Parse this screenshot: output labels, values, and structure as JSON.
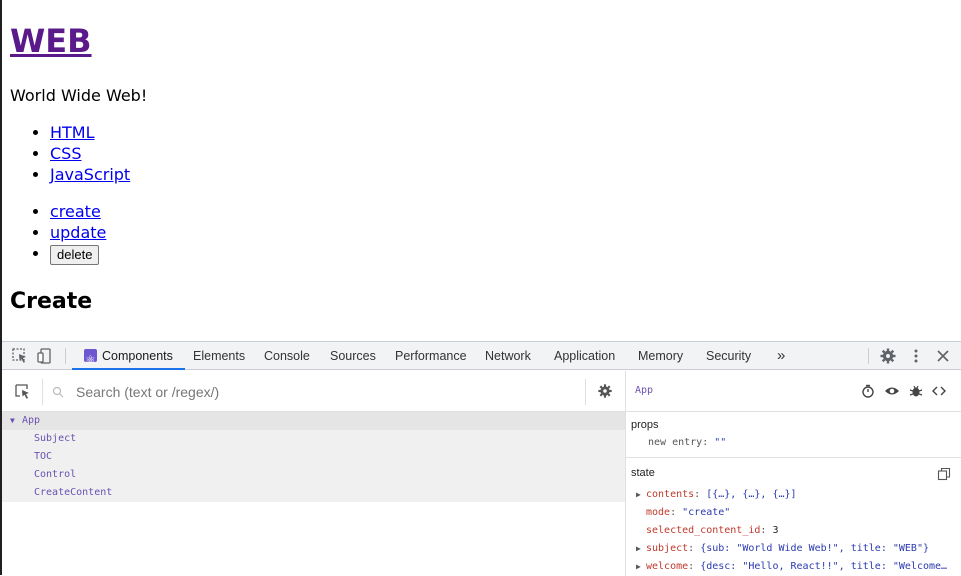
{
  "page": {
    "title": "WEB",
    "description": "World Wide Web!",
    "toc": [
      "HTML",
      "CSS",
      "JavaScript"
    ],
    "controls": {
      "create": "create",
      "update": "update",
      "delete": "delete"
    },
    "heading": "Create"
  },
  "devtools": {
    "tabs": [
      "Components",
      "Elements",
      "Console",
      "Sources",
      "Performance",
      "Network",
      "Application",
      "Memory",
      "Security"
    ],
    "more": "»",
    "search_placeholder": "Search (text or /regex/)",
    "tree": [
      "App",
      "Subject",
      "TOC",
      "Control",
      "CreateContent"
    ],
    "selected_component": "App",
    "props_title": "props",
    "props": [
      {
        "key": "new entry",
        "value": "\"\""
      }
    ],
    "state_title": "state",
    "state": [
      {
        "key": "contents",
        "value": "[{…}, {…}, {…}]",
        "expandable": true
      },
      {
        "key": "mode",
        "value": "\"create\"",
        "expandable": false
      },
      {
        "key": "selected_content_id",
        "value": "3",
        "expandable": false
      },
      {
        "key": "subject",
        "value": "{sub: \"World Wide Web!\", title: \"WEB\"}",
        "expandable": true
      },
      {
        "key": "welcome",
        "value": "{desc: \"Hello, React!!\", title: \"Welcome…",
        "expandable": true
      }
    ]
  }
}
